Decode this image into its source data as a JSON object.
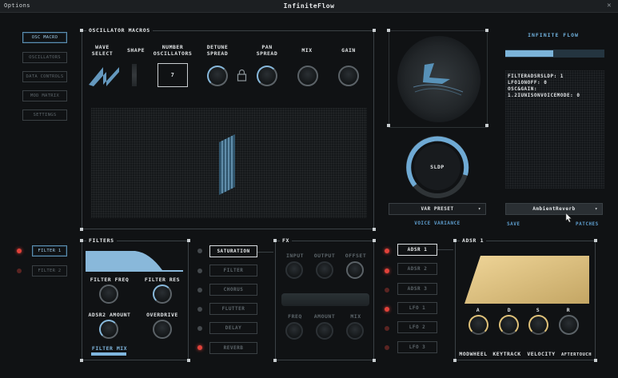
{
  "app": {
    "menu": "Options",
    "title": "InfiniteFlow",
    "close": "✕"
  },
  "nav": [
    {
      "label": "OSC MACRO",
      "active": true
    },
    {
      "label": "OSCILLATORS"
    },
    {
      "label": "DATA CONTROLS"
    },
    {
      "label": "MOD MATRIX"
    },
    {
      "label": "SETTINGS"
    }
  ],
  "osc": {
    "header": "OSCILLATOR MACROS",
    "wave_select": "WAVE\nSELECT",
    "shape": "SHAPE",
    "number_oscillators": "NUMBER\nOSCILLATORS",
    "number_value": "7",
    "detune_spread": "DETUNE\nSPREAD",
    "pan_spread": "PAN\nSPREAD",
    "mix": "MIX",
    "gain": "GAIN"
  },
  "voice": {
    "knob_label": "SLDP",
    "preset": "VAR PRESET",
    "variance": "VOICE VARIANCE"
  },
  "info": {
    "title": "INFINITE FLOW",
    "lines": [
      "FILTERADSRSLDP: 1",
      "LFO1ONOFF: 0",
      "OSC&GAIN:",
      "1.2IUNISONVOICEMODE: 0"
    ],
    "dropdown": "AmbientReverb",
    "save": "SAVE",
    "patches": "PATCHES"
  },
  "filters": {
    "side": [
      "FILTER 1",
      "FILTER 2"
    ],
    "header": "FILTERS",
    "freq": "FILTER FREQ",
    "res": "FILTER RES",
    "adsr2": "ADSR2 AMOUNT",
    "overdrive": "OVERDRIVE",
    "mix": "FILTER MIX"
  },
  "fx": {
    "buttons": [
      "SATURATION",
      "FILTER",
      "CHORUS",
      "FLUTTER",
      "DELAY",
      "REVERB"
    ],
    "header": "FX",
    "top": [
      "INPUT",
      "OUTPUT",
      "OFFSET"
    ],
    "bottom": [
      "FREQ",
      "AMOUNT",
      "MIX"
    ]
  },
  "mod": {
    "buttons": [
      "ADSR 1",
      "ADSR 2",
      "ADSR 3",
      "LFO 1",
      "LFO 2",
      "LFO 3"
    ]
  },
  "adsr": {
    "header": "ADSR 1",
    "knobs": [
      "A",
      "D",
      "S",
      "R"
    ],
    "bottom": [
      "MODWHEEL",
      "KEYTRACK",
      "VELOCITY",
      "AFTERTOUCH"
    ]
  },
  "colors": {
    "accent": "#88b9dc",
    "gold": "#e0c27a",
    "led": "#e2423a"
  }
}
